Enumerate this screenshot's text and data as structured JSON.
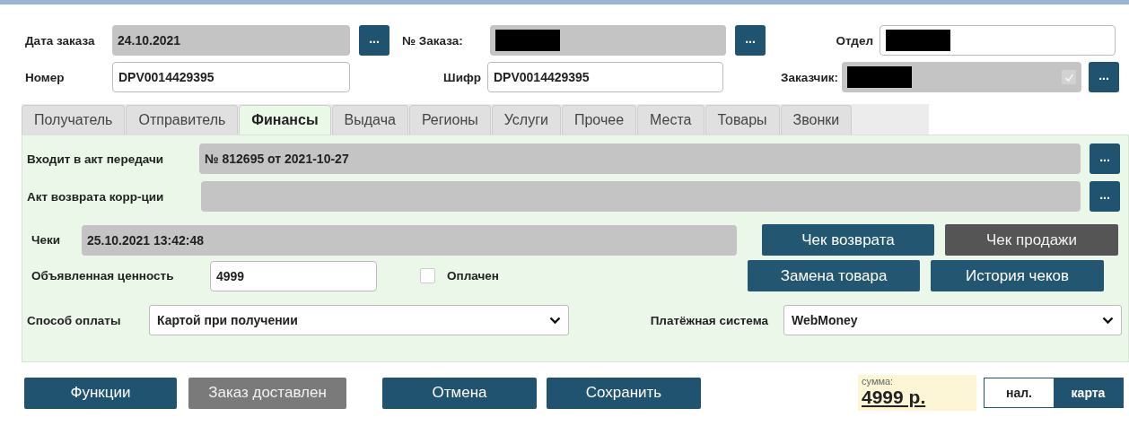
{
  "header": {
    "order_date": {
      "label": "Дата заказа",
      "value": "24.10.2021",
      "button": "..."
    },
    "order_no": {
      "label": "№ Заказа:",
      "redacted": true,
      "button": "..."
    },
    "department": {
      "label": "Отдел",
      "redacted": true
    },
    "number": {
      "label": "Номер",
      "value": "DPV0014429395"
    },
    "cipher": {
      "label": "Шифр",
      "value": "DPV0014429395"
    },
    "customer": {
      "label": "Заказчик:",
      "redacted": true,
      "checked": true,
      "button": "..."
    }
  },
  "tabs": [
    {
      "label": "Получатель",
      "selected": false
    },
    {
      "label": "Отправитель",
      "selected": false
    },
    {
      "label": "Финансы",
      "selected": true
    },
    {
      "label": "Выдача",
      "selected": false
    },
    {
      "label": "Регионы",
      "selected": false
    },
    {
      "label": "Услуги",
      "selected": false
    },
    {
      "label": "Прочее",
      "selected": false
    },
    {
      "label": "Места",
      "selected": false
    },
    {
      "label": "Товары",
      "selected": false
    },
    {
      "label": "Звонки",
      "selected": false
    }
  ],
  "finance": {
    "transfer_act": {
      "label": "Входит в акт передачи",
      "value": "№ 812695 от 2021-10-27",
      "button": "..."
    },
    "return_act": {
      "label": "Акт возврата корр-ции",
      "button": "..."
    },
    "receipts": {
      "label": "Чеки",
      "value": "25.10.2021 13:42:48"
    },
    "receipt_buttons": [
      {
        "label": "Чек возврата",
        "disabled": false
      },
      {
        "label": "Чек продажи",
        "disabled": true
      },
      {
        "label": "Замена товара",
        "disabled": false
      },
      {
        "label": "История чеков",
        "disabled": false
      }
    ],
    "declared_value": {
      "label": "Объявленная ценность",
      "value": "4999"
    },
    "paid": {
      "label": "Оплачен",
      "checked": false
    },
    "payment_method": {
      "label": "Способ оплаты",
      "value": "Картой при получении"
    },
    "payment_system": {
      "label": "Платёжная система",
      "value": "WebMoney"
    }
  },
  "actions": [
    {
      "label": "Функции",
      "disabled": false
    },
    {
      "label": "Заказ доставлен",
      "disabled": true
    },
    {
      "label": "Отмена",
      "disabled": false
    },
    {
      "label": "Сохранить",
      "disabled": false
    }
  ],
  "total": {
    "label": "сумма:",
    "value": "4999 р."
  },
  "payment_toggle": [
    {
      "label": "нал.",
      "selected": false
    },
    {
      "label": "карта",
      "selected": true
    }
  ]
}
